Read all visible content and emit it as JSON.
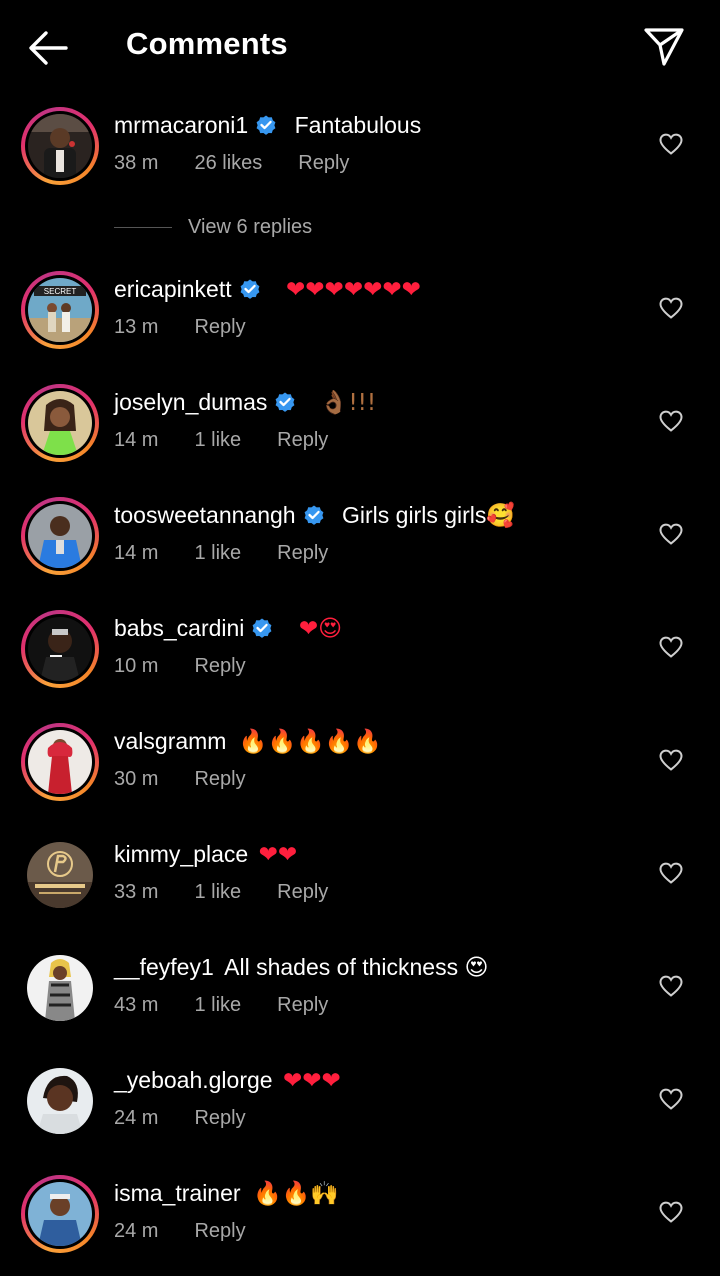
{
  "header": {
    "title": "Comments"
  },
  "view_replies": "View 6 replies",
  "icons": {
    "back": "arrow-left-icon",
    "share": "paper-plane-icon",
    "like": "heart-outline-icon",
    "verified": "verified-badge-icon"
  },
  "colors": {
    "background": "#000000",
    "meta": "#a8a8a8",
    "verified": "#3797f0",
    "ring": "#e1306c"
  },
  "comments": [
    {
      "username": "mrmacaroni1",
      "verified": true,
      "text": "Fantabulous",
      "time": "38 m",
      "likes": "26 likes",
      "reply": "Reply"
    },
    {
      "username": "ericapinkett",
      "verified": true,
      "text": "❤❤❤❤❤❤❤",
      "time": "13 m",
      "likes": "",
      "reply": "Reply"
    },
    {
      "username": "joselyn_dumas",
      "verified": true,
      "text": "👌🏾!!!",
      "time": "14 m",
      "likes": "1 like",
      "reply": "Reply"
    },
    {
      "username": "toosweetannangh",
      "verified": true,
      "text": "Girls girls girls🥰",
      "time": "14 m",
      "likes": "1 like",
      "reply": "Reply"
    },
    {
      "username": "babs_cardini",
      "verified": true,
      "text": "❤😍",
      "time": "10 m",
      "likes": "",
      "reply": "Reply"
    },
    {
      "username": "valsgramm",
      "verified": false,
      "text": "🔥🔥🔥🔥🔥",
      "time": "30 m",
      "likes": "",
      "reply": "Reply"
    },
    {
      "username": "kimmy_place",
      "verified": false,
      "text": "❤❤",
      "time": "33 m",
      "likes": "1 like",
      "reply": "Reply"
    },
    {
      "username": "__feyfey1",
      "verified": false,
      "text": "All shades of thickness 😍",
      "time": "43 m",
      "likes": "1 like",
      "reply": "Reply"
    },
    {
      "username": "_yeboah.glorge",
      "verified": false,
      "text": "❤❤❤",
      "time": "24 m",
      "likes": "",
      "reply": "Reply"
    },
    {
      "username": "isma_trainer",
      "verified": false,
      "text": "🔥🔥🙌",
      "time": "24 m",
      "likes": "",
      "reply": "Reply"
    }
  ]
}
